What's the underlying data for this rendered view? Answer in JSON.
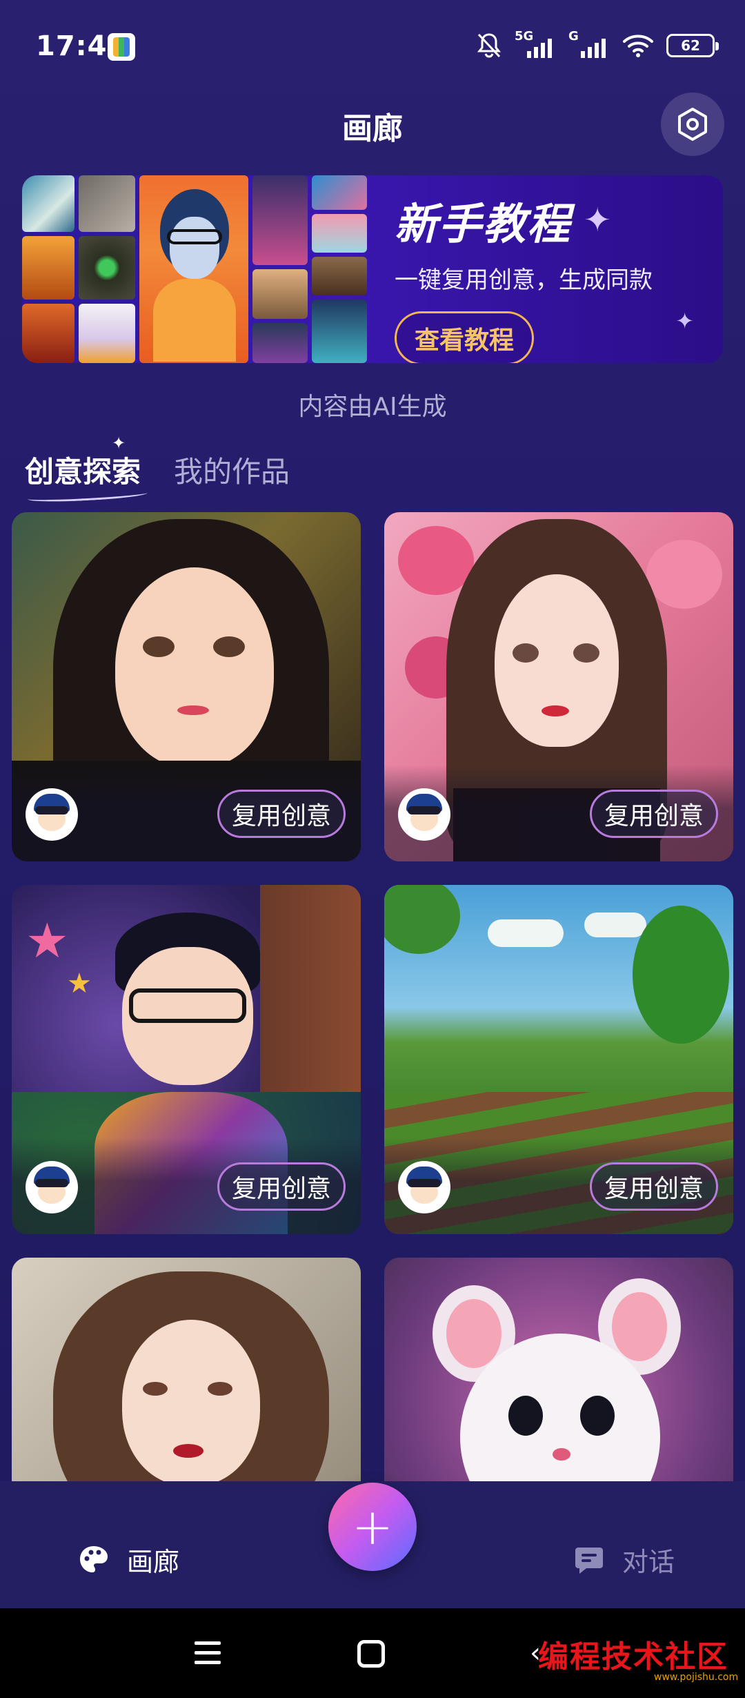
{
  "status": {
    "time": "17:41",
    "network_labels": [
      "5G",
      "G"
    ],
    "battery": "62"
  },
  "header": {
    "title": "画廊",
    "settings_icon": "hexagon-settings-icon"
  },
  "banner": {
    "title": "新手教程",
    "subtitle": "一键复用创意，生成同款",
    "button": "查看教程"
  },
  "ai_note": "内容由AI生成",
  "tabs": [
    {
      "label": "创意探索",
      "active": true
    },
    {
      "label": "我的作品",
      "active": false
    }
  ],
  "cards": [
    {
      "subject": "anime girl with dark hair and earrings",
      "button": "复用创意"
    },
    {
      "subject": "anime girl with pink roses",
      "button": "复用创意"
    },
    {
      "subject": "boy with glasses under starry sky",
      "button": "复用创意"
    },
    {
      "subject": "green field landscape",
      "button": "复用创意"
    },
    {
      "subject": "girl with curly hair and flowers",
      "button": null
    },
    {
      "subject": "white mouse character",
      "button": null
    }
  ],
  "fab": {
    "icon": "plus-icon",
    "symbol": "+"
  },
  "bottom_nav": [
    {
      "label": "画廊",
      "icon": "palette-icon",
      "active": true
    },
    {
      "label": "对话",
      "icon": "chat-bubble-icon",
      "active": false
    }
  ],
  "watermark": {
    "text": "编程技术社区",
    "small": "www.pojishu.com"
  }
}
